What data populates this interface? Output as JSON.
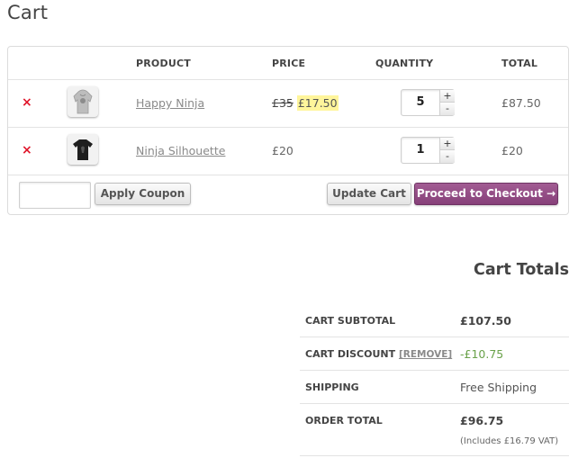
{
  "page": {
    "title": "Cart"
  },
  "table": {
    "headers": {
      "product": "PRODUCT",
      "price": "PRICE",
      "quantity": "QUANTITY",
      "total": "TOTAL"
    },
    "items": [
      {
        "remove": "×",
        "name": "Happy Ninja",
        "price_old": "£35",
        "price": "£17.50",
        "quantity": "5",
        "total": "£87.50",
        "thumb": "hoodie-icon"
      },
      {
        "remove": "×",
        "name": "Ninja Silhouette",
        "price_old": "",
        "price": "£20",
        "quantity": "1",
        "total": "£20",
        "thumb": "tshirt-icon"
      }
    ],
    "plus": "+",
    "minus": "-"
  },
  "actions": {
    "coupon_placeholder": "",
    "apply_coupon": "Apply Coupon",
    "update_cart": "Update Cart",
    "checkout": "Proceed to Checkout →"
  },
  "totals": {
    "title": "Cart Totals",
    "rows": [
      {
        "label": "CART SUBTOTAL",
        "value": "£107.50"
      },
      {
        "label": "CART DISCOUNT",
        "link": "[REMOVE]",
        "value": "-£10.75"
      },
      {
        "label": "SHIPPING",
        "value": "Free Shipping"
      },
      {
        "label": "ORDER TOTAL",
        "value": "£96.75",
        "note": "(Includes £16.79 VAT)"
      }
    ]
  },
  "colors": {
    "accent": "#96588a",
    "remove": "#e0162b",
    "discount": "#6aa24a",
    "highlight": "#fff59b"
  }
}
